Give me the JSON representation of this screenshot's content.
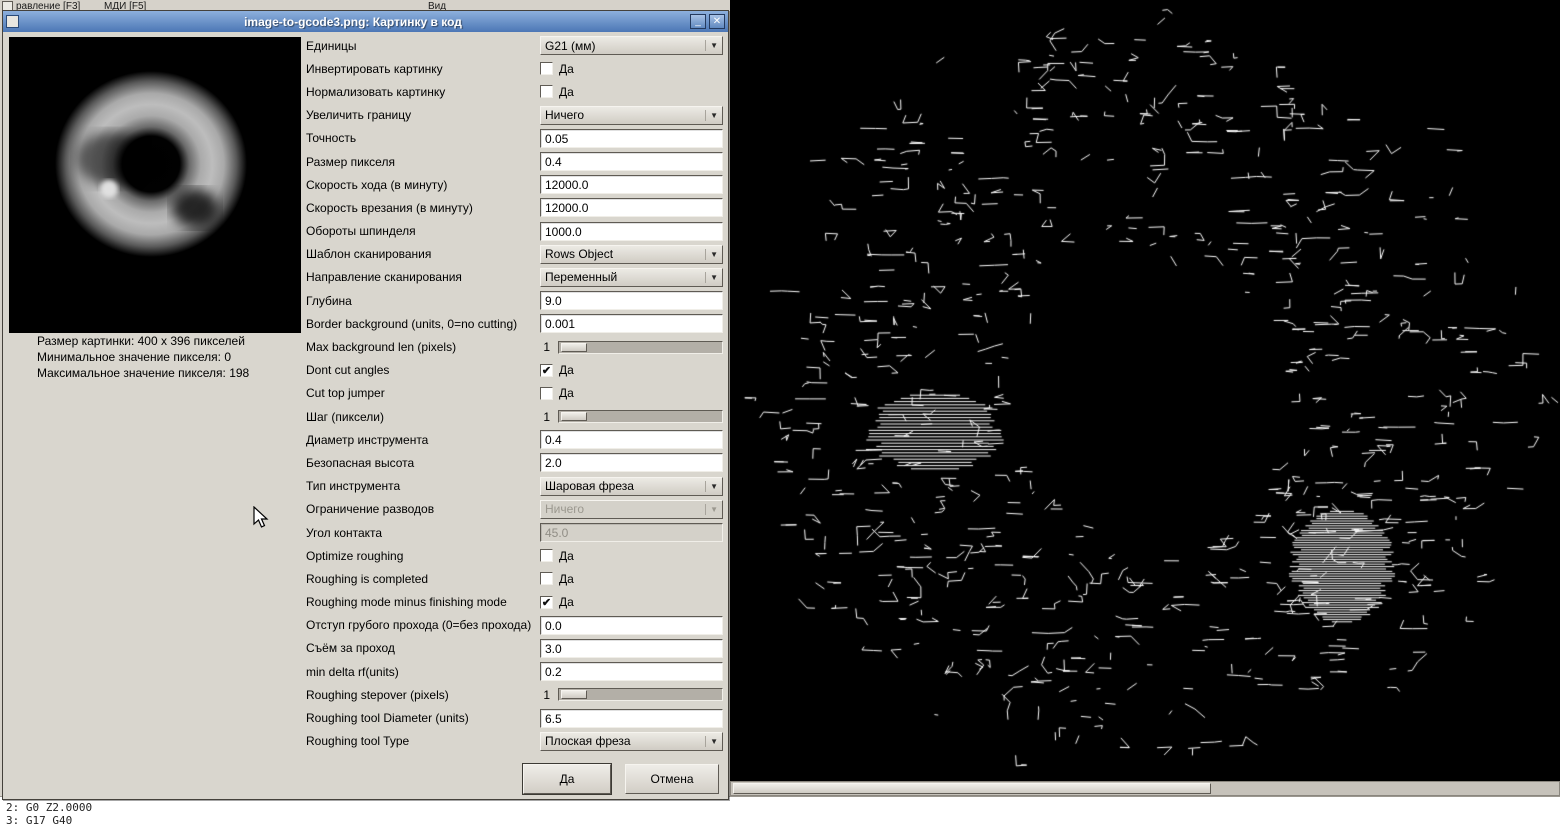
{
  "background": {
    "tab_fragment_1": "равление [F3]",
    "tab_fragment_2": "МДИ [F5]",
    "menu_fragment": "Вид",
    "gcode_lines": [
      "2: G0 Z2.0000",
      "3: G17 G40"
    ]
  },
  "dialog": {
    "title": "image-to-gcode3.png: Картинку в код",
    "window_buttons": {
      "minimize": "_",
      "close": "✕"
    },
    "preview": {
      "info_lines": [
        "Размер картинки: 400 x 396 пикселей",
        "Минимальное значение пикселя: 0",
        "Максимальное значение пикселя: 198"
      ]
    },
    "form": {
      "rows": [
        {
          "name": "units",
          "label": "Единицы",
          "type": "select",
          "value": "G21 (мм)"
        },
        {
          "name": "invert-image",
          "label": "Инвертировать картинку",
          "type": "checkbox",
          "value": "Да",
          "checked": false
        },
        {
          "name": "normalize-image",
          "label": "Нормализовать картинку",
          "type": "checkbox",
          "value": "Да",
          "checked": false
        },
        {
          "name": "expand-border",
          "label": "Увеличить границу",
          "type": "select",
          "value": "Ничего"
        },
        {
          "name": "tolerance",
          "label": "Точность",
          "type": "entry",
          "value": "0.05"
        },
        {
          "name": "pixel-size",
          "label": "Размер пикселя",
          "type": "entry",
          "value": "0.4"
        },
        {
          "name": "feed-rate",
          "label": "Скорость хода (в минуту)",
          "type": "entry",
          "value": "12000.0"
        },
        {
          "name": "plunge-rate",
          "label": "Скорость врезания (в минуту)",
          "type": "entry",
          "value": "12000.0"
        },
        {
          "name": "spindle-speed",
          "label": "Обороты шпинделя",
          "type": "entry",
          "value": "1000.0"
        },
        {
          "name": "scan-pattern",
          "label": "Шаблон сканирования",
          "type": "select",
          "value": "Rows Object"
        },
        {
          "name": "scan-direction",
          "label": "Направление сканирования",
          "type": "select",
          "value": "Переменный"
        },
        {
          "name": "depth",
          "label": "Глубина",
          "type": "entry",
          "value": "9.0"
        },
        {
          "name": "border-background",
          "label": "Border background (units, 0=no cutting)",
          "type": "entry",
          "value": "0.001"
        },
        {
          "name": "max-background-len",
          "label": "Max background len (pixels)",
          "type": "slider",
          "value": "1"
        },
        {
          "name": "dont-cut-angles",
          "label": "Dont cut angles",
          "type": "checkbox",
          "value": "Да",
          "checked": true
        },
        {
          "name": "cut-top-jumper",
          "label": "Cut top jumper",
          "type": "checkbox",
          "value": "Да",
          "checked": false
        },
        {
          "name": "step-pixels",
          "label": "Шаг (пиксели)",
          "type": "slider",
          "value": "1"
        },
        {
          "name": "tool-diameter",
          "label": "Диаметр инструмента",
          "type": "entry",
          "value": "0.4"
        },
        {
          "name": "safety-height",
          "label": "Безопасная высота",
          "type": "entry",
          "value": "2.0"
        },
        {
          "name": "tool-type",
          "label": "Тип инструмента",
          "type": "select",
          "value": "Шаровая фреза"
        },
        {
          "name": "lace-bounding",
          "label": "Ограничение разводов",
          "type": "select",
          "value": "Ничего",
          "disabled": true
        },
        {
          "name": "contact-angle",
          "label": "Угол контакта",
          "type": "entry",
          "value": "45.0",
          "disabled": true
        },
        {
          "name": "optimize-roughing",
          "label": "Optimize roughing",
          "type": "checkbox",
          "value": "Да",
          "checked": false
        },
        {
          "name": "roughing-is-completed",
          "label": "Roughing is completed",
          "type": "checkbox",
          "value": "Да",
          "checked": false
        },
        {
          "name": "roughing-minus-finishing",
          "label": "Roughing mode minus finishing mode",
          "type": "checkbox",
          "value": "Да",
          "checked": true
        },
        {
          "name": "roughing-offset",
          "label": "Отступ грубого прохода (0=без прохода)",
          "type": "entry",
          "value": "0.0"
        },
        {
          "name": "depth-per-pass",
          "label": "Съём за проход",
          "type": "entry",
          "value": "3.0"
        },
        {
          "name": "min-delta-rf",
          "label": "min delta rf(units)",
          "type": "entry",
          "value": "0.2"
        },
        {
          "name": "roughing-stepover",
          "label": "Roughing stepover (pixels)",
          "type": "slider",
          "value": "1"
        },
        {
          "name": "roughing-tool-diameter",
          "label": "Roughing tool Diameter (units)",
          "type": "entry",
          "value": "6.5"
        },
        {
          "name": "roughing-tool-type",
          "label": "Roughing tool Type",
          "type": "select",
          "value": "Плоская фреза"
        }
      ]
    },
    "buttons": {
      "ok": "Да",
      "cancel": "Отмена"
    }
  },
  "colors": {
    "titlebar_blue": "#4c77b5",
    "dialog_bg": "#d9d6ce",
    "plot_bg": "#000000",
    "toolpath": "#ffffff"
  }
}
